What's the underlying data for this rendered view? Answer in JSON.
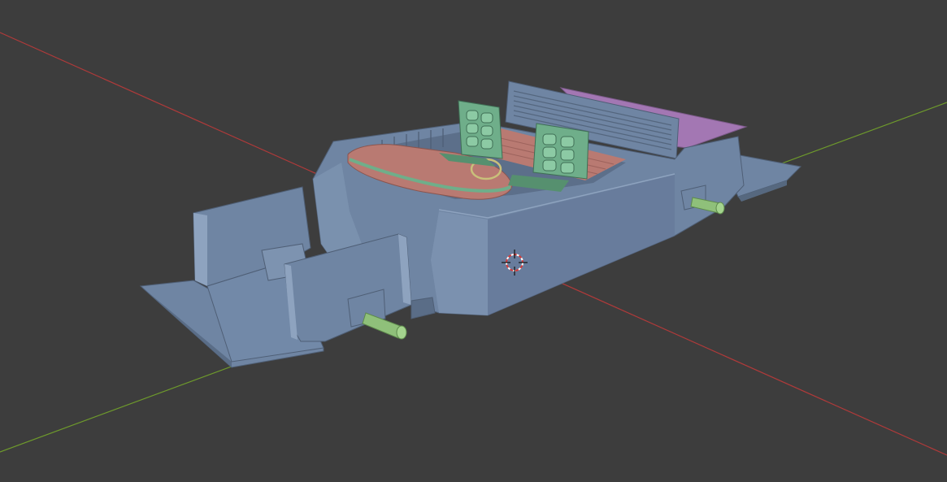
{
  "viewport": {
    "background": "#3d3d3d",
    "axis_x_color": "#b03a3a",
    "axis_y_color": "#6e9a2c"
  },
  "model": {
    "body_color": "#6f85a3",
    "body_shadow": "#5a6d87",
    "body_highlight": "#8ea3bf",
    "seat_color": "#6fae8a",
    "seat_shadow": "#56906f",
    "interior_color": "#b97a72",
    "interior_shadow": "#9c625c",
    "trunk_color": "#a377b3",
    "axle_color": "#8fc07a"
  },
  "icons": {
    "cursor": "3d-cursor-icon"
  }
}
